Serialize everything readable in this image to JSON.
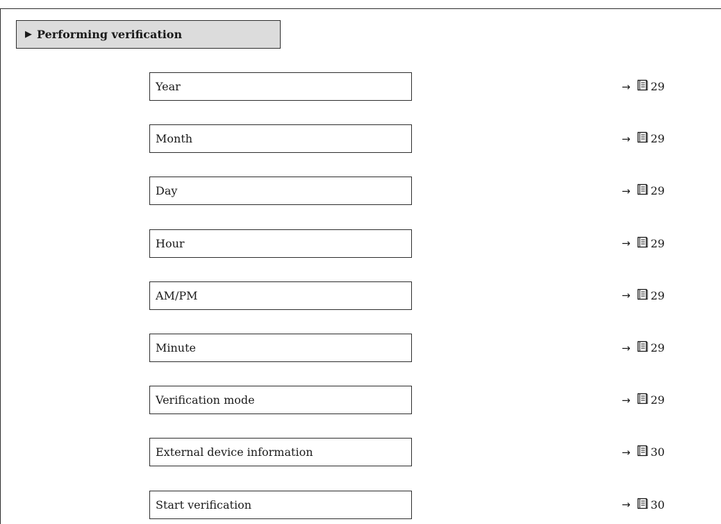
{
  "section": {
    "title": "Performing verification"
  },
  "parameters": [
    {
      "label": "Year",
      "page": "29"
    },
    {
      "label": "Month",
      "page": "29"
    },
    {
      "label": "Day",
      "page": "29"
    },
    {
      "label": "Hour",
      "page": "29"
    },
    {
      "label": "AM/PM",
      "page": "29"
    },
    {
      "label": "Minute",
      "page": "29"
    },
    {
      "label": "Verification mode",
      "page": "29"
    },
    {
      "label": "External device information",
      "page": "30"
    },
    {
      "label": "Start verification",
      "page": "30"
    }
  ],
  "icons": {
    "expand": "triangle-right-icon",
    "reference": "arrow-right-icon",
    "page": "book-icon"
  }
}
